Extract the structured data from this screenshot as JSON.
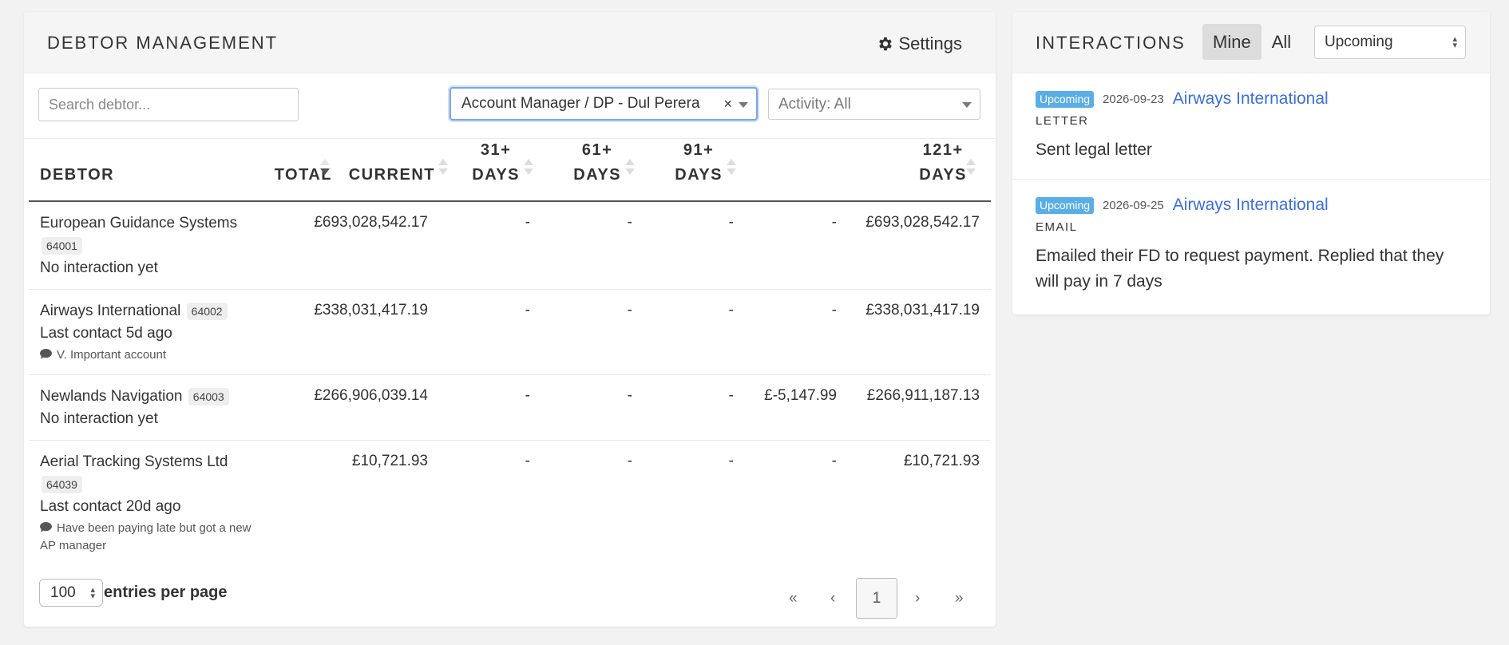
{
  "debtor_panel": {
    "title": "DEBTOR MANAGEMENT",
    "settings_label": "Settings",
    "search_placeholder": "Search debtor...",
    "manager_filter": "Account Manager / DP - Dul Perera",
    "activity_filter": "Activity: All"
  },
  "table": {
    "headers": {
      "debtor": "DEBTOR",
      "total": "TOTAL",
      "current": "CURRENT",
      "d31a": "31+",
      "d31b": "DAYS",
      "d61a": "61+",
      "d61b": "DAYS",
      "d91a": "91+",
      "d91b": "DAYS",
      "d121a": "121+",
      "d121b": "DAYS"
    },
    "rows": [
      {
        "name": "European Guidance Systems",
        "id": "64001",
        "status": "No interaction yet",
        "note": "",
        "total": "£693,028,542.17",
        "current": "-",
        "d31": "-",
        "d61": "-",
        "d91": "-",
        "d121": "£693,028,542.17"
      },
      {
        "name": "Airways International",
        "id": "64002",
        "status": "Last contact 5d ago",
        "note": "V. Important account",
        "total": "£338,031,417.19",
        "current": "-",
        "d31": "-",
        "d61": "-",
        "d91": "-",
        "d121": "£338,031,417.19"
      },
      {
        "name": "Newlands Navigation",
        "id": "64003",
        "status": "No interaction yet",
        "note": "",
        "total": "£266,906,039.14",
        "current": "-",
        "d31": "-",
        "d61": "-",
        "d91": "£-5,147.99",
        "d121": "£266,911,187.13"
      },
      {
        "name": "Aerial Tracking Systems Ltd",
        "id": "64039",
        "status": "Last contact 20d ago",
        "note": "Have been paying late but got a new AP manager",
        "total": "£10,721.93",
        "current": "-",
        "d31": "-",
        "d61": "-",
        "d91": "-",
        "d121": "£10,721.93"
      }
    ]
  },
  "footer": {
    "page_size": "100",
    "entries_label": "entries per page",
    "first": "«",
    "prev": "‹",
    "current_page": "1",
    "next": "›",
    "last": "»"
  },
  "interactions_panel": {
    "title": "INTERACTIONS",
    "toggle_mine": "Mine",
    "toggle_all": "All",
    "filter": "Upcoming",
    "items": [
      {
        "badge": "Upcoming",
        "date": "2026-09-23",
        "debtor": "Airways International",
        "type": "LETTER",
        "text": "Sent legal letter"
      },
      {
        "badge": "Upcoming",
        "date": "2026-09-25",
        "debtor": "Airways International",
        "type": "EMAIL",
        "text": "Emailed their FD to request payment. Replied that they will pay in 7 days"
      }
    ]
  },
  "colors": {
    "badge_blue": "#5aaee6",
    "link_blue": "#3b6fd8",
    "focus_border": "#7aa7e0"
  }
}
